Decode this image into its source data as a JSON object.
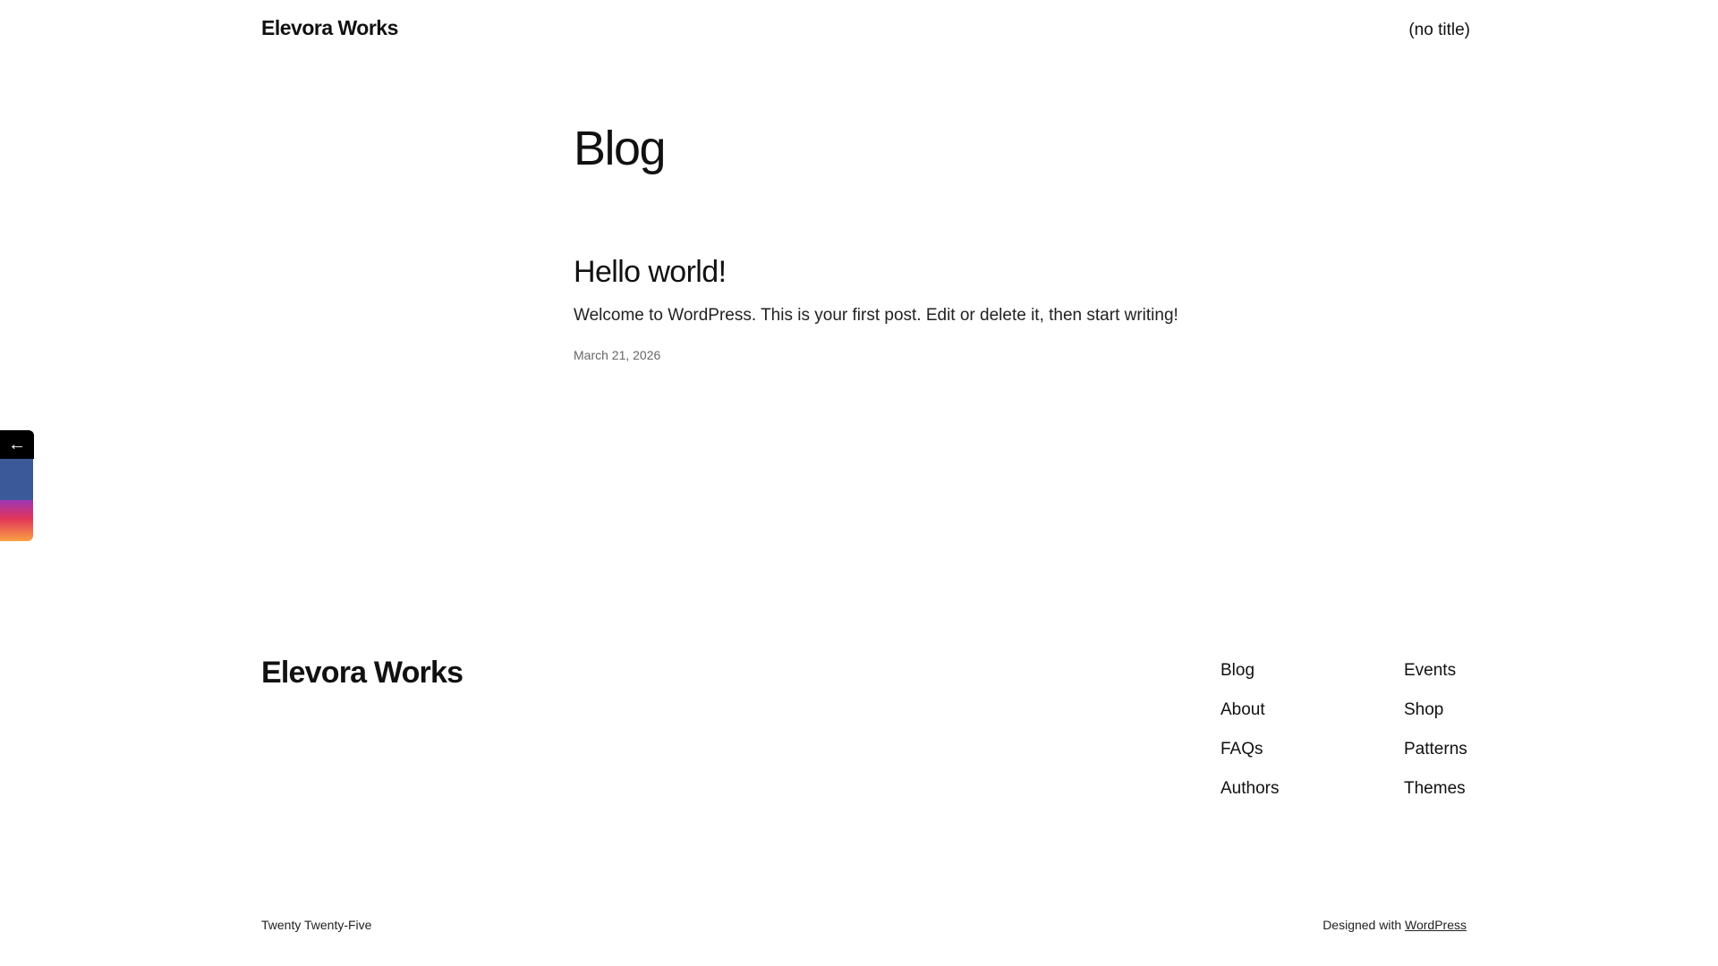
{
  "header": {
    "site_title": "Elevora Works",
    "nav_item": "(no title)"
  },
  "main": {
    "page_title": "Blog",
    "posts": [
      {
        "title": "Hello world!",
        "excerpt": "Welcome to WordPress. This is your first post. Edit or delete it, then start writing!",
        "date": "March 21, 2026"
      }
    ]
  },
  "share_bar": {
    "toggle_glyph": "←",
    "facebook_icon": "facebook-icon",
    "facebook_glyph": "",
    "instagram_icon": "instagram-icon",
    "instagram_glyph": "",
    "facebook_color": "#3b5998"
  },
  "footer": {
    "brand": "Elevora Works",
    "nav_col_1": [
      "Blog",
      "About",
      "FAQs",
      "Authors"
    ],
    "nav_col_2": [
      "Events",
      "Shop",
      "Patterns",
      "Themes"
    ],
    "theme_name": "Twenty Twenty-Five",
    "credit_prefix": "Designed with",
    "credit_link": "WordPress"
  }
}
